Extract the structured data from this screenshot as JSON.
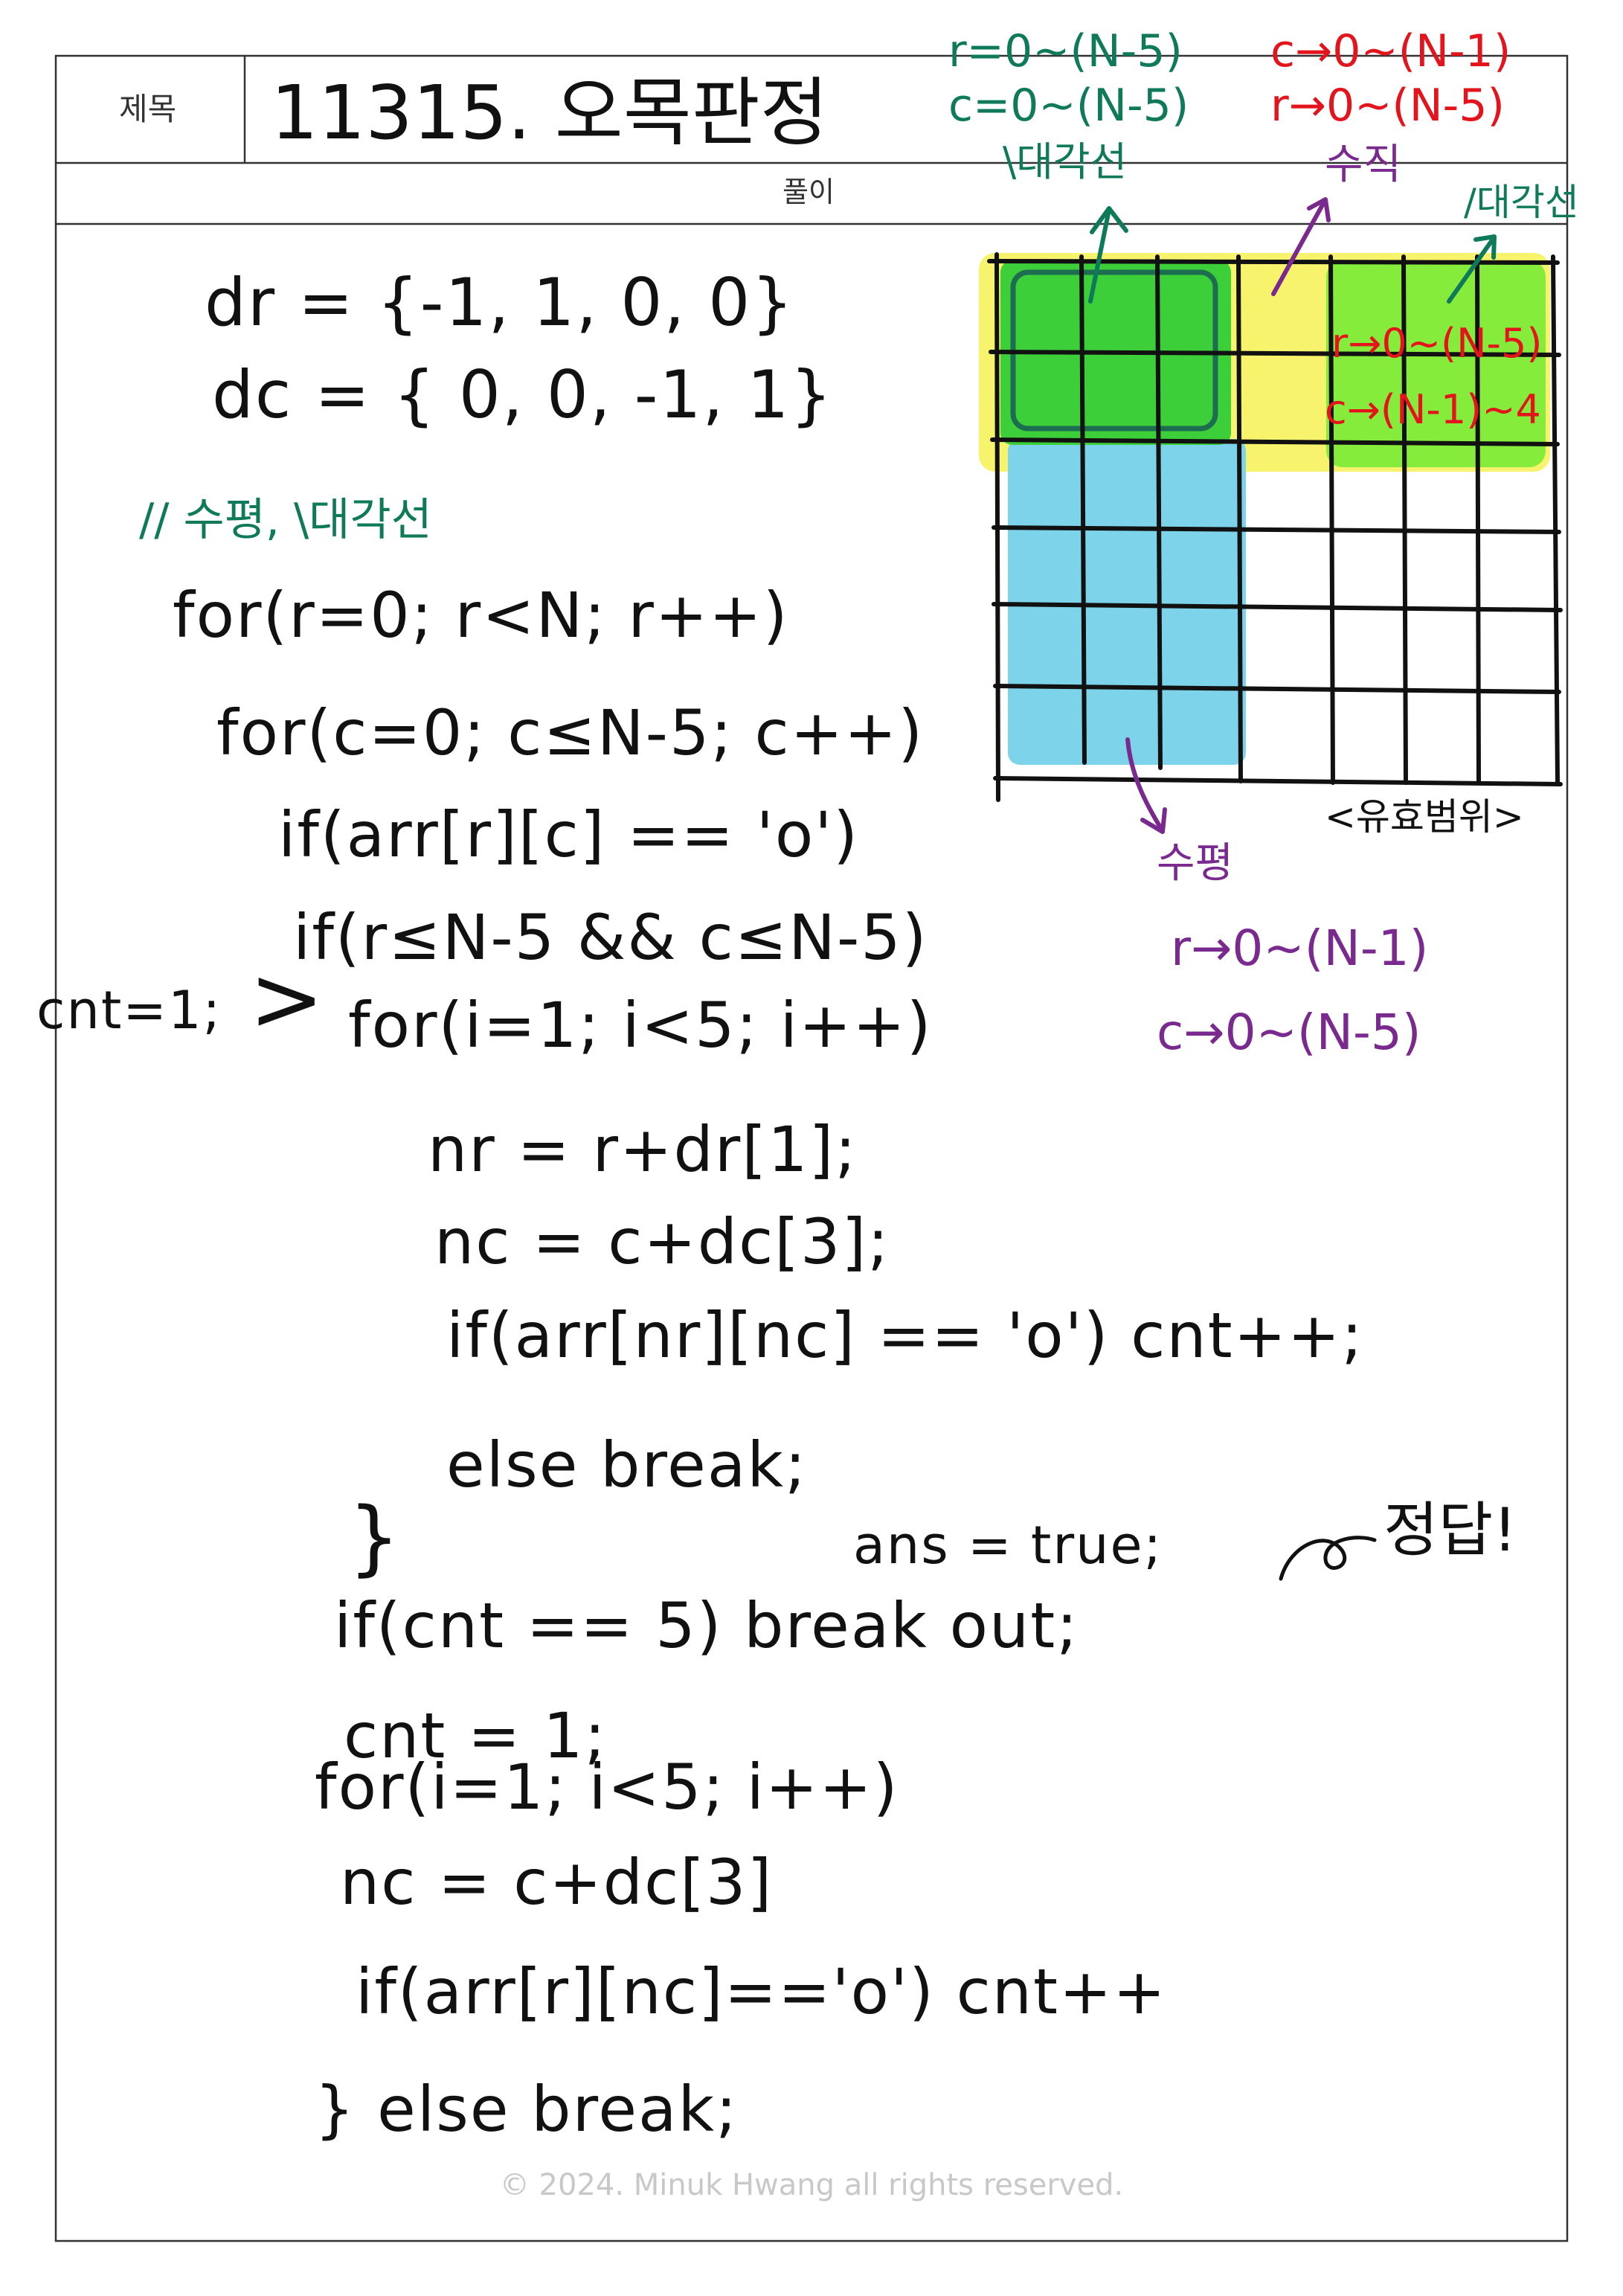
{
  "header": {
    "title_label": "제목",
    "title": "11315. 오목판정",
    "solution_label": "풀이"
  },
  "code": {
    "direction_rows": "dr = {-1, 1, 0, 0}",
    "direction_cols": "dc = { 0, 0, -1, 1}",
    "comment": "// 수평, \\대각선",
    "outer_loop": "for(r=0; r<N; r++)",
    "inner_loop": "for(c=0; c≤N-5; c++)",
    "stone_check": "if(arr[r][c] == 'o')",
    "range_check": "if(r≤N-5 && c≤N-5)",
    "cnt_init": "cnt=1;",
    "cnt_bracket": ">",
    "diag_loop": "for(i=1; i<5; i++)",
    "next_row": "nr = r+dr[1];",
    "next_col": "nc = c+dc[3];",
    "diag_check": "if(arr[nr][nc] == 'o') cnt++;",
    "diag_else": "else break;",
    "diag_close": "}",
    "answer_set": "ans = true;",
    "win_check": "if(cnt == 5) break out;",
    "answer_note": "정답!",
    "cnt_reset": "cnt = 1;",
    "horiz_loop": "for(i=1; i<5; i++)",
    "horiz_next_col": "nc = c+dc[3]",
    "horiz_check": "if(arr[r][nc]=='o') cnt++",
    "horiz_else": "} else break;"
  },
  "annotations": {
    "diag_backslash": {
      "r_range": "r=0~(N-5)",
      "c_range": "c=0~(N-5)",
      "label": "\\대각선"
    },
    "vertical": {
      "c_range": "c→0~(N-1)",
      "r_range": "r→0~(N-5)",
      "label": "수직"
    },
    "diag_slash": {
      "label": "/대각선",
      "r_range": "r→0~(N-5)",
      "c_range": "c→(N-1)~4"
    },
    "horizontal": {
      "label": "수평",
      "r_range": "r→0~(N-1)",
      "c_range": "c→0~(N-5)"
    },
    "grid_caption": "<유효범위>"
  },
  "footer": {
    "copyright": "© 2024. Minuk Hwang all rights reserved."
  },
  "colors": {
    "ink": "#111111",
    "green_ink": "#0f7a5a",
    "red_ink": "#e3141c",
    "purple_ink": "#7a2a8e",
    "yellow_highlight": "#f8f36c",
    "green_highlight": "#3ccf3a",
    "lime_highlight": "#86ec3c",
    "blue_highlight": "#7dd3ea"
  }
}
